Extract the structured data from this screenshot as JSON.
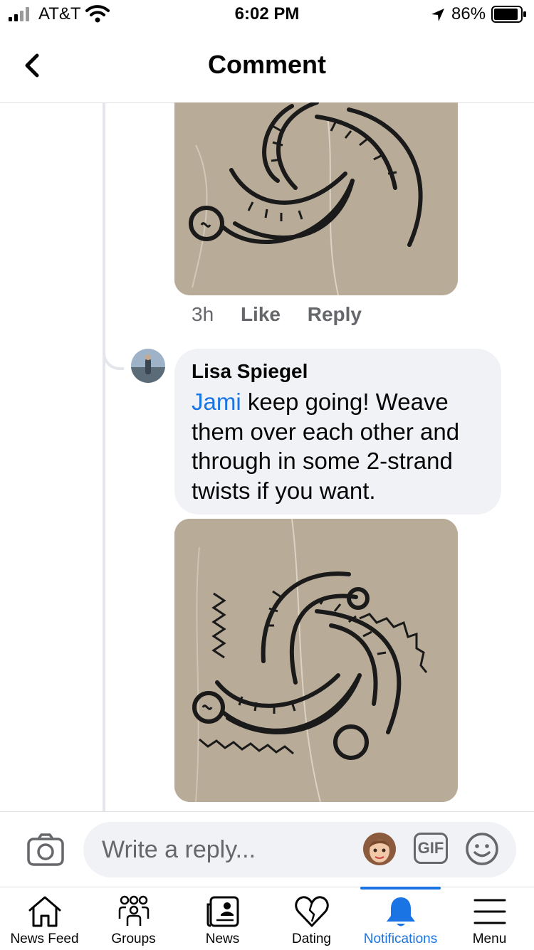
{
  "status_bar": {
    "carrier": "AT&T",
    "time": "6:02 PM",
    "battery_percent": "86%",
    "icons": [
      "signal-icon",
      "wifi-icon",
      "location-arrow-icon",
      "battery-icon"
    ]
  },
  "header": {
    "title": "Comment",
    "back_icon": "chevron-left-icon"
  },
  "previous_comment": {
    "time": "3h",
    "like_label": "Like",
    "reply_label": "Reply"
  },
  "reply_comment": {
    "author": "Lisa Spiegel",
    "mention": "Jami",
    "text": " keep going! Weave them over each other and through in some 2-strand twists if you want."
  },
  "composer": {
    "placeholder": "Write a reply...",
    "gif_label": "GIF",
    "icons": [
      "camera-icon",
      "avatar-sticker-icon",
      "gif-icon",
      "smiley-icon"
    ]
  },
  "tabbar": {
    "tabs": [
      {
        "label": "News Feed",
        "icon": "home-icon",
        "active": false
      },
      {
        "label": "Groups",
        "icon": "groups-icon",
        "active": false
      },
      {
        "label": "News",
        "icon": "news-icon",
        "active": false
      },
      {
        "label": "Dating",
        "icon": "heart-icon",
        "active": false
      },
      {
        "label": "Notifications",
        "icon": "bell-icon",
        "active": true
      },
      {
        "label": "Menu",
        "icon": "hamburger-icon",
        "active": false
      }
    ]
  },
  "colors": {
    "accent": "#1b74e4",
    "bubble": "#f0f2f5",
    "secondary_text": "#65676b"
  }
}
